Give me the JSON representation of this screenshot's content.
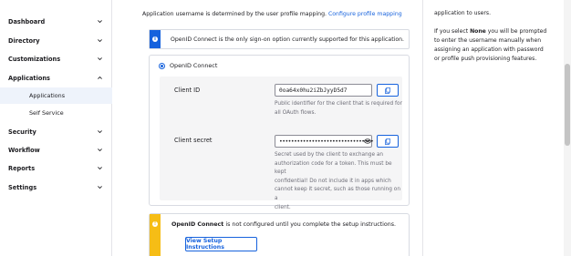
{
  "sidebar": {
    "items": [
      {
        "label": "Dashboard",
        "expanded": false
      },
      {
        "label": "Directory",
        "expanded": false
      },
      {
        "label": "Customizations",
        "expanded": false
      },
      {
        "label": "Applications",
        "expanded": true
      },
      {
        "label": "Security",
        "expanded": false
      },
      {
        "label": "Workflow",
        "expanded": false
      },
      {
        "label": "Reports",
        "expanded": false
      },
      {
        "label": "Settings",
        "expanded": false
      }
    ],
    "subitems": [
      {
        "label": "Applications",
        "active": true
      },
      {
        "label": "Self Service",
        "active": false
      }
    ]
  },
  "main": {
    "intro_text": "Application username is determined by the user profile mapping.",
    "intro_link": "Configure profile mapping",
    "info_banner": "OpenID Connect is the only sign-on option currently supported for this application.",
    "radio_label": "OpenID Connect",
    "client_id": {
      "label": "Client ID",
      "value": "0oa64x0hu2iZbJyyD5d7",
      "help": [
        "Public identifier for the client that is required for",
        "all OAuth flows."
      ]
    },
    "client_secret": {
      "label": "Client secret",
      "value": "••••••••••••••••••••••••••••••••",
      "help": [
        "Secret used by the client to exchange an",
        "authorization code for a token. This must be kept",
        "confidential! Do not include it in apps which",
        "cannot keep it secret, such as those running on a",
        "client."
      ]
    },
    "warning": {
      "bold": "OpenID Connect",
      "rest": " is not configured until you complete the setup instructions.",
      "button": "View Setup Instructions"
    }
  },
  "aside": {
    "line0": "application to users.",
    "p2_before": "If you select ",
    "p2_bold": "None",
    "p2_after": " you will be prompted",
    "p2_lines": [
      "to enter the username manually when",
      "assigning an application with password",
      "or profile push provisioning features."
    ]
  },
  "colors": {
    "accent": "#1662dd",
    "warning": "#f6bd16",
    "active_bg": "#eef3fb"
  },
  "icons": {
    "chevron": "chevron-icon",
    "copy": "copy-icon",
    "eye": "eye-icon",
    "info": "info-icon",
    "warning": "warning-icon"
  }
}
